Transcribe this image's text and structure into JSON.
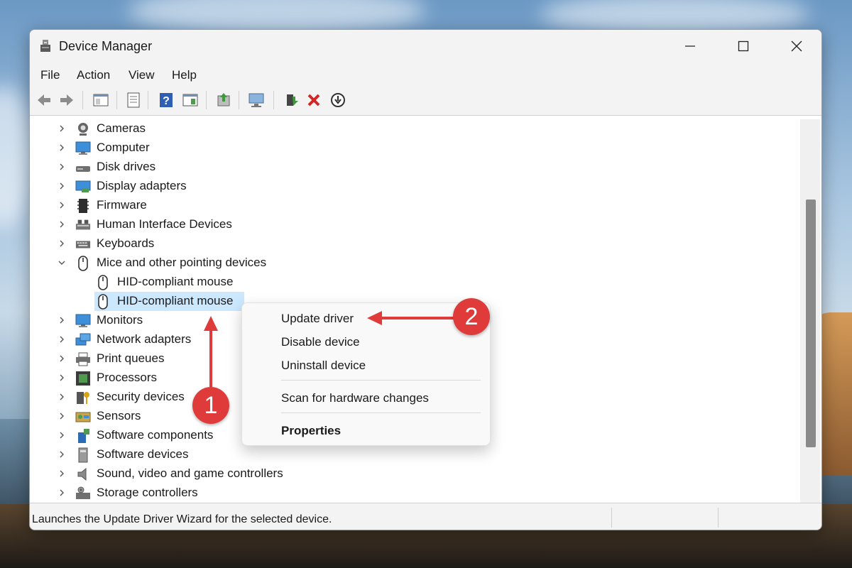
{
  "window": {
    "title": "Device Manager",
    "icon": "device-manager-icon"
  },
  "menu": [
    "File",
    "Action",
    "View",
    "Help"
  ],
  "toolbar": {
    "icons": [
      "back-arrow-icon",
      "forward-arrow-icon",
      "show-hide-tree-icon",
      "properties-icon",
      "help-icon",
      "action-pane-icon",
      "update-driver-icon",
      "scan-hardware-icon",
      "enable-device-icon",
      "uninstall-icon",
      "disable-device-icon"
    ]
  },
  "tree": {
    "rows": [
      {
        "label": "Cameras",
        "icon": "camera-icon",
        "expanded": false,
        "level": 0
      },
      {
        "label": "Computer",
        "icon": "computer-icon",
        "expanded": false,
        "level": 0
      },
      {
        "label": "Disk drives",
        "icon": "disk-drive-icon",
        "expanded": false,
        "level": 0
      },
      {
        "label": "Display adapters",
        "icon": "display-adapter-icon",
        "expanded": false,
        "level": 0
      },
      {
        "label": "Firmware",
        "icon": "firmware-icon",
        "expanded": false,
        "level": 0
      },
      {
        "label": "Human Interface Devices",
        "icon": "hid-icon",
        "expanded": false,
        "level": 0
      },
      {
        "label": "Keyboards",
        "icon": "keyboard-icon",
        "expanded": false,
        "level": 0
      },
      {
        "label": "Mice and other pointing devices",
        "icon": "mouse-icon",
        "expanded": true,
        "level": 0
      },
      {
        "label": "HID-compliant mouse",
        "icon": "mouse-icon",
        "level": 1
      },
      {
        "label": "HID-compliant mouse",
        "icon": "mouse-icon",
        "level": 1,
        "selected": true
      },
      {
        "label": "Monitors",
        "icon": "monitor-icon",
        "expanded": false,
        "level": 0
      },
      {
        "label": "Network adapters",
        "icon": "network-adapter-icon",
        "expanded": false,
        "level": 0
      },
      {
        "label": "Print queues",
        "icon": "printer-icon",
        "expanded": false,
        "level": 0
      },
      {
        "label": "Processors",
        "icon": "processor-icon",
        "expanded": false,
        "level": 0
      },
      {
        "label": "Security devices",
        "icon": "security-device-icon",
        "expanded": false,
        "level": 0
      },
      {
        "label": "Sensors",
        "icon": "sensor-icon",
        "expanded": false,
        "level": 0
      },
      {
        "label": "Software components",
        "icon": "software-component-icon",
        "expanded": false,
        "level": 0
      },
      {
        "label": "Software devices",
        "icon": "software-device-icon",
        "expanded": false,
        "level": 0
      },
      {
        "label": "Sound, video and game controllers",
        "icon": "speaker-icon",
        "expanded": false,
        "level": 0
      },
      {
        "label": "Storage controllers",
        "icon": "storage-controller-icon",
        "expanded": false,
        "level": 0
      }
    ]
  },
  "context_menu": {
    "items": [
      {
        "label": "Update driver"
      },
      {
        "label": "Disable device"
      },
      {
        "label": "Uninstall device"
      },
      {
        "label": "Scan for hardware changes"
      },
      {
        "label": "Properties",
        "bold": true
      }
    ]
  },
  "status": {
    "text": "Launches the Update Driver Wizard for the selected device."
  },
  "annotations": [
    {
      "number": "1",
      "color": "#e03b3b"
    },
    {
      "number": "2",
      "color": "#e03b3b"
    }
  ]
}
